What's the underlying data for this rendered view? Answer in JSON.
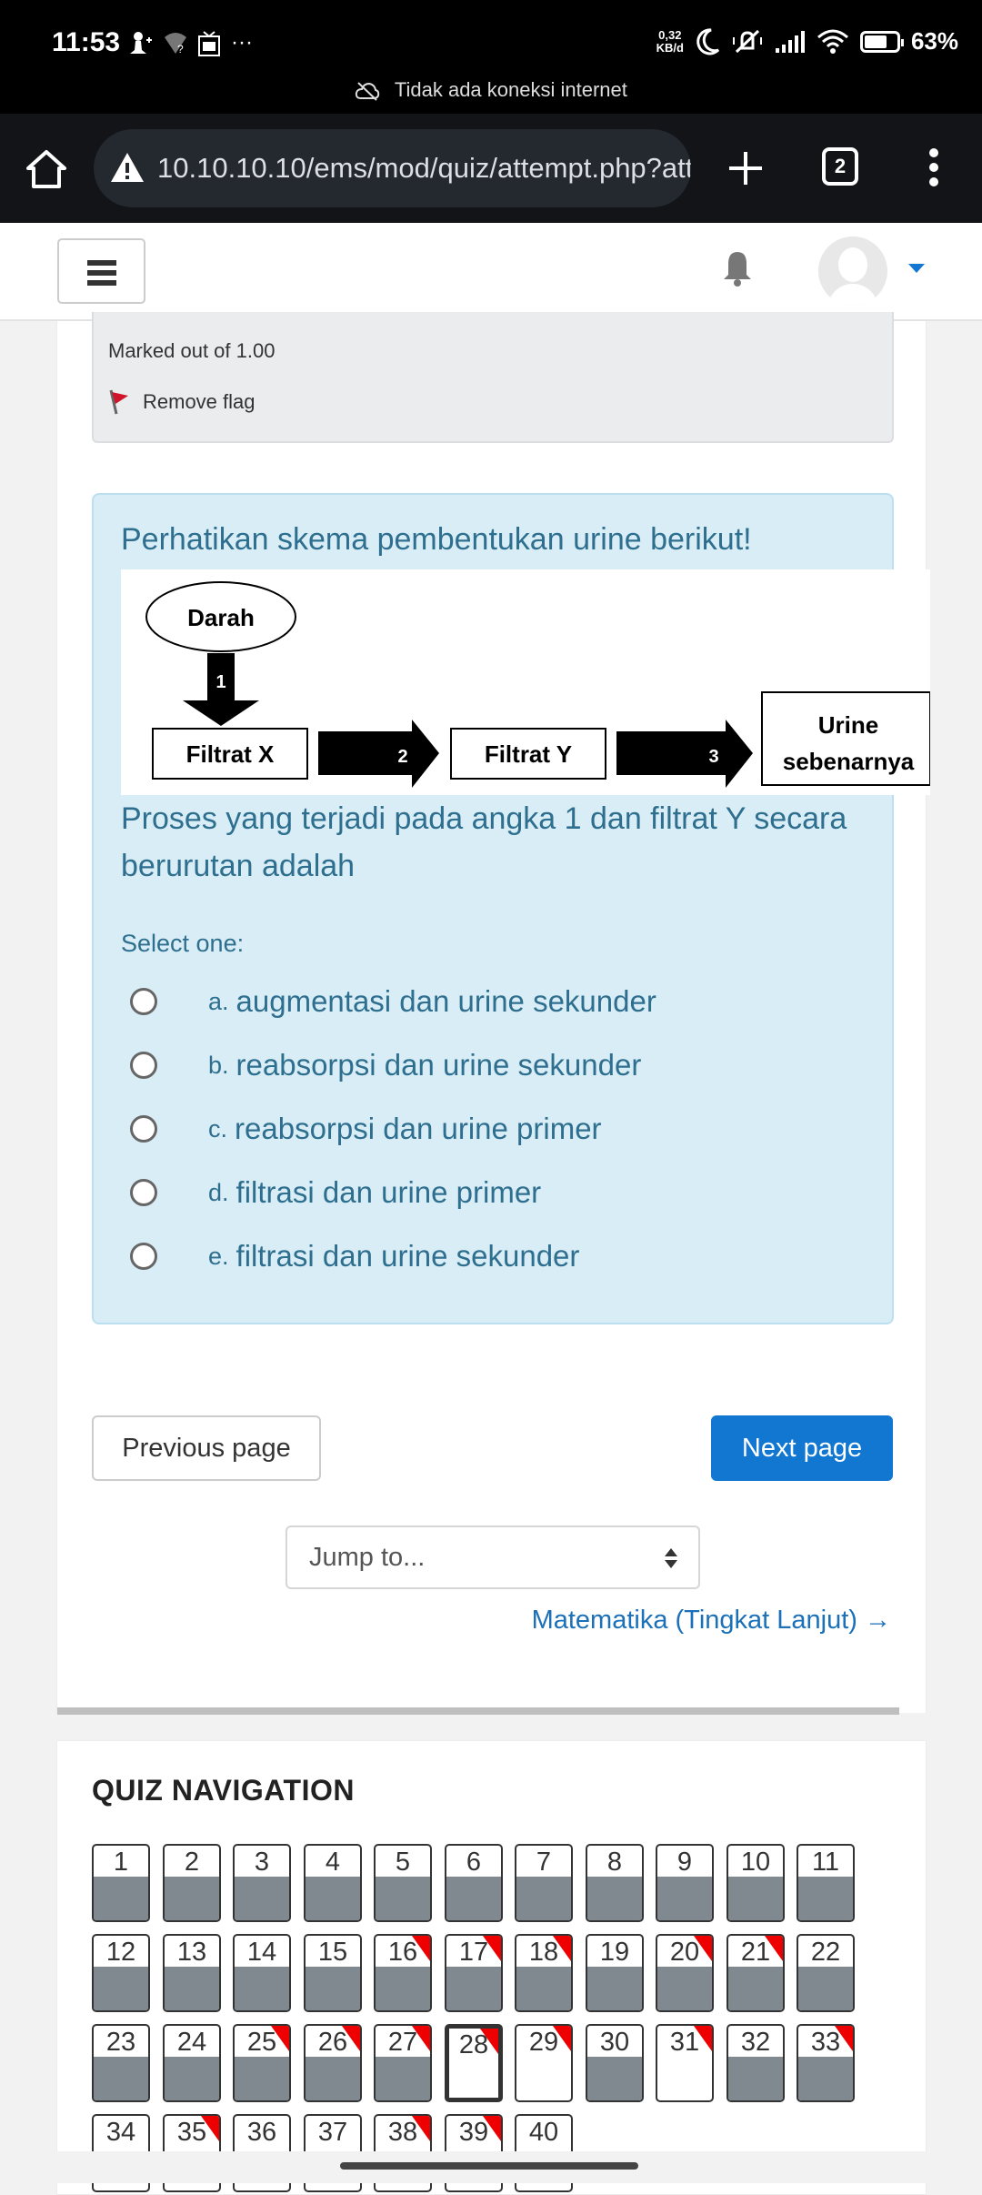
{
  "status_bar": {
    "time": "11:53",
    "left_icons": [
      "person-add-icon",
      "wifi-unknown-icon",
      "gift-icon",
      "more-icon"
    ],
    "more_label": "···",
    "data_rate_value": "0,32",
    "data_rate_unit": "KB/d",
    "battery_percent": "63",
    "battery_percent_label": "63%",
    "right_icons": [
      "moon-icon",
      "bell-off-icon",
      "signal-icon",
      "wifi-icon",
      "battery-icon"
    ]
  },
  "offline_banner": {
    "text": "Tidak ada koneksi internet",
    "icon": "cloud-off-icon"
  },
  "browser": {
    "url": "10.10.10.10/ems/mod/quiz/attempt.php?att",
    "tab_count": "2",
    "icons": [
      "home-icon",
      "warning-icon",
      "plus-icon",
      "tabs-icon",
      "menu-icon"
    ]
  },
  "navbar": {
    "icons": [
      "hamburger-icon",
      "bell-icon",
      "avatar",
      "caret-down-icon"
    ],
    "accent_color": "#1177d1"
  },
  "question_info": {
    "marked_out_of": "Marked out of 1.00",
    "flag_label": "Remove flag"
  },
  "question": {
    "title": "Perhatikan skema pembentukan urine berikut!",
    "diagram": {
      "start": "Darah",
      "arrow1": "1",
      "node1": "Filtrat X",
      "arrow2": "2",
      "node2": "Filtrat Y",
      "arrow3": "3",
      "node3_line1": "Urine",
      "node3_line2": "sebenarnya"
    },
    "text": "Proses yang terjadi pada angka 1 dan filtrat Y secara berurutan adalah",
    "select_prompt": "Select one:",
    "answers": [
      {
        "letter": "a.",
        "text": "augmentasi dan urine sekunder",
        "selected": false
      },
      {
        "letter": "b.",
        "text": "reabsorpsi dan urine sekunder",
        "selected": false
      },
      {
        "letter": "c.",
        "text": "reabsorpsi dan urine primer",
        "selected": false
      },
      {
        "letter": "d.",
        "text": "filtrasi dan urine primer",
        "selected": false
      },
      {
        "letter": "e.",
        "text": "filtrasi dan urine sekunder",
        "selected": false
      }
    ]
  },
  "pagination": {
    "previous_label": "Previous page",
    "next_label": "Next page",
    "jump_placeholder": "Jump to...",
    "next_activity_label": "Matematika (Tingkat Lanjut) →"
  },
  "quiz_navigation": {
    "title": "QUIZ NAVIGATION",
    "current": 28,
    "questions": [
      {
        "n": "1",
        "answered": true,
        "flagged": false
      },
      {
        "n": "2",
        "answered": true,
        "flagged": false
      },
      {
        "n": "3",
        "answered": true,
        "flagged": false
      },
      {
        "n": "4",
        "answered": true,
        "flagged": false
      },
      {
        "n": "5",
        "answered": true,
        "flagged": false
      },
      {
        "n": "6",
        "answered": true,
        "flagged": false
      },
      {
        "n": "7",
        "answered": true,
        "flagged": false
      },
      {
        "n": "8",
        "answered": true,
        "flagged": false
      },
      {
        "n": "9",
        "answered": true,
        "flagged": false
      },
      {
        "n": "10",
        "answered": true,
        "flagged": false
      },
      {
        "n": "11",
        "answered": true,
        "flagged": false
      },
      {
        "n": "12",
        "answered": true,
        "flagged": false
      },
      {
        "n": "13",
        "answered": true,
        "flagged": false
      },
      {
        "n": "14",
        "answered": true,
        "flagged": false
      },
      {
        "n": "15",
        "answered": true,
        "flagged": false
      },
      {
        "n": "16",
        "answered": true,
        "flagged": true
      },
      {
        "n": "17",
        "answered": true,
        "flagged": true
      },
      {
        "n": "18",
        "answered": true,
        "flagged": true
      },
      {
        "n": "19",
        "answered": true,
        "flagged": false
      },
      {
        "n": "20",
        "answered": true,
        "flagged": true
      },
      {
        "n": "21",
        "answered": true,
        "flagged": true
      },
      {
        "n": "22",
        "answered": true,
        "flagged": false
      },
      {
        "n": "23",
        "answered": true,
        "flagged": false
      },
      {
        "n": "24",
        "answered": true,
        "flagged": false
      },
      {
        "n": "25",
        "answered": true,
        "flagged": true
      },
      {
        "n": "26",
        "answered": true,
        "flagged": true
      },
      {
        "n": "27",
        "answered": true,
        "flagged": true
      },
      {
        "n": "28",
        "answered": false,
        "flagged": true
      },
      {
        "n": "29",
        "answered": false,
        "flagged": true
      },
      {
        "n": "30",
        "answered": true,
        "flagged": false
      },
      {
        "n": "31",
        "answered": false,
        "flagged": true
      },
      {
        "n": "32",
        "answered": true,
        "flagged": false
      },
      {
        "n": "33",
        "answered": true,
        "flagged": true
      },
      {
        "n": "34",
        "answered": false,
        "flagged": false
      },
      {
        "n": "35",
        "answered": false,
        "flagged": true
      },
      {
        "n": "36",
        "answered": false,
        "flagged": false
      },
      {
        "n": "37",
        "answered": false,
        "flagged": false
      },
      {
        "n": "38",
        "answered": false,
        "flagged": true
      },
      {
        "n": "39",
        "answered": false,
        "flagged": true
      },
      {
        "n": "40",
        "answered": false,
        "flagged": false
      }
    ],
    "colors": {
      "answered_fill": "#808990",
      "flag": "#ee0000"
    }
  }
}
